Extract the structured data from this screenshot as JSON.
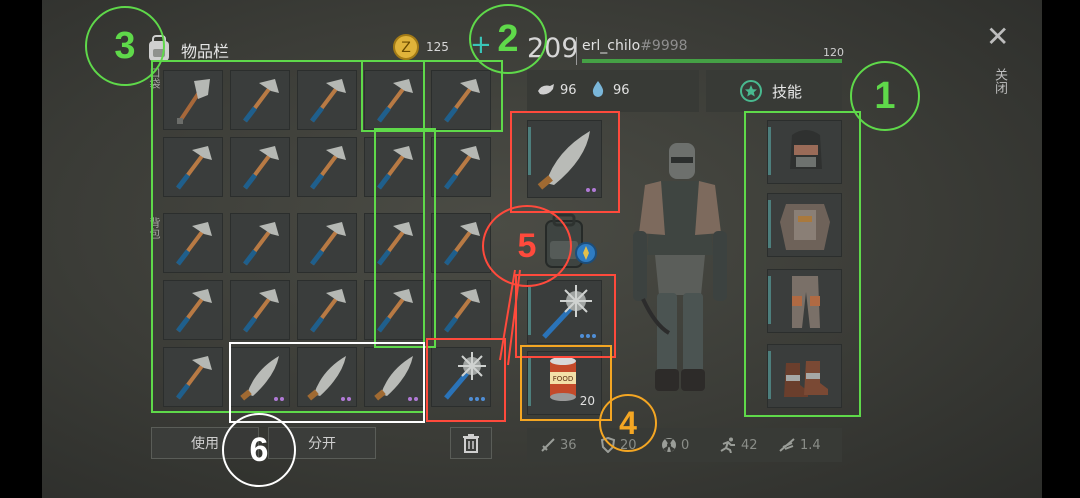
{
  "inventory": {
    "title": "物品栏",
    "side_label_top": "口袋",
    "side_label_bottom": "背包"
  },
  "currency": {
    "amount": "125",
    "plus": "+"
  },
  "player": {
    "level": "209",
    "name": "erl_chilo",
    "tag": "#9998",
    "xp": "120"
  },
  "needs": {
    "food": "96",
    "water": "96"
  },
  "skills": {
    "label": "技能"
  },
  "close": {
    "icon": "✕",
    "label": "关闭"
  },
  "buttons": {
    "use": "使用",
    "split": "分开"
  },
  "consumable": {
    "count": "20",
    "label": "FOOD"
  },
  "stats": {
    "attack": "36",
    "armor": "20",
    "radiation": "0",
    "speed": "42",
    "weight": "1.4"
  },
  "annotations": {
    "1": "1",
    "2": "2",
    "3": "3",
    "4": "4",
    "5": "5",
    "6": "6"
  },
  "colors": {
    "green": "#5fd94a",
    "red": "#ff4a3c",
    "orange": "#f4a623",
    "white": "#ffffff",
    "teal": "#4d7f7d"
  }
}
